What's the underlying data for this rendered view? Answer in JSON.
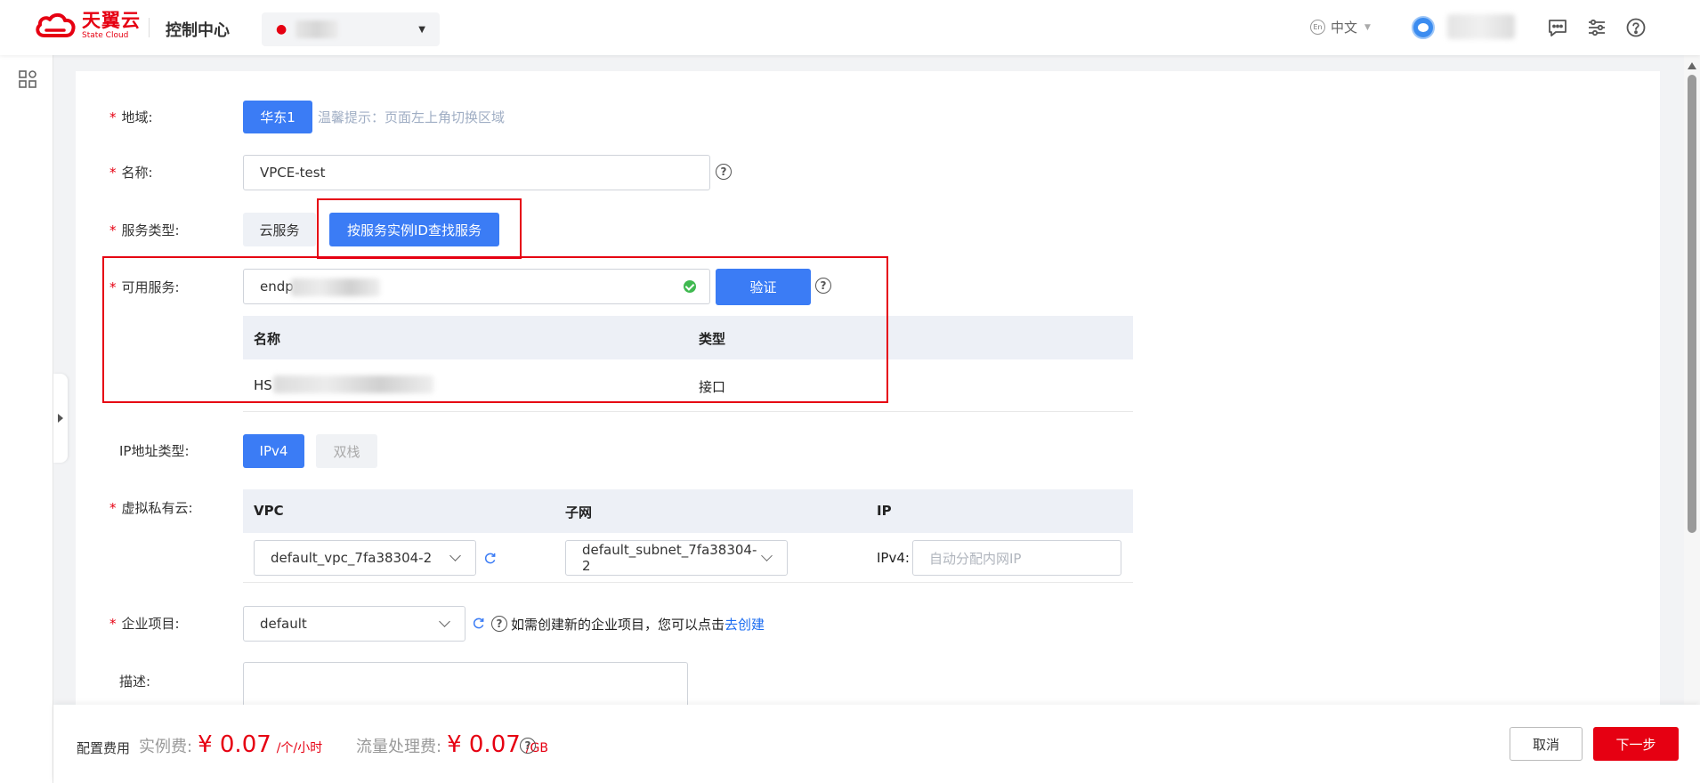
{
  "header": {
    "logo_cn": "天翼云",
    "logo_en": "State Cloud",
    "console_title": "控制中心",
    "language": "中文",
    "lang_badge": "En"
  },
  "form": {
    "region": {
      "label": "地域:",
      "button": "华东1",
      "hint": "温馨提示：页面左上角切换区域"
    },
    "name": {
      "label": "名称:",
      "value": "VPCE-test"
    },
    "service_type": {
      "label": "服务类型:",
      "option_cloud": "云服务",
      "option_by_id": "按服务实例ID查找服务"
    },
    "available_service": {
      "label": "可用服务:",
      "value_prefix": "endp",
      "verify_button": "验证",
      "table": {
        "headers": [
          "名称",
          "类型"
        ],
        "row": {
          "name_prefix": "HS",
          "type": "接口"
        }
      }
    },
    "ip_type": {
      "label": "IP地址类型:",
      "ipv4": "IPv4",
      "dual": "双栈"
    },
    "vpc": {
      "label": "虚拟私有云:",
      "headers": [
        "VPC",
        "子网",
        "IP"
      ],
      "vpc_value": "default_vpc_7fa38304-2",
      "subnet_value": "default_subnet_7fa38304-2",
      "ip_prefix": "IPv4:",
      "ip_placeholder": "自动分配内网IP"
    },
    "enterprise": {
      "label": "企业项目:",
      "value": "default",
      "hint": "如需创建新的企业项目，您可以点击",
      "link": "去创建"
    },
    "description": {
      "label": "描述:"
    }
  },
  "footer": {
    "fee_label": "配置费用",
    "instance_fee_label": "实例费:",
    "instance_fee_value": "¥ 0.07",
    "instance_fee_unit": "/个/小时",
    "traffic_fee_label": "流量处理费:",
    "traffic_fee_value": "¥ 0.07",
    "traffic_fee_unit": "/GB",
    "cancel": "取消",
    "next": "下一步"
  },
  "colors": {
    "brand_red": "#e60012",
    "primary_blue": "#3b7cf5",
    "link_blue": "#1a6bf0"
  }
}
